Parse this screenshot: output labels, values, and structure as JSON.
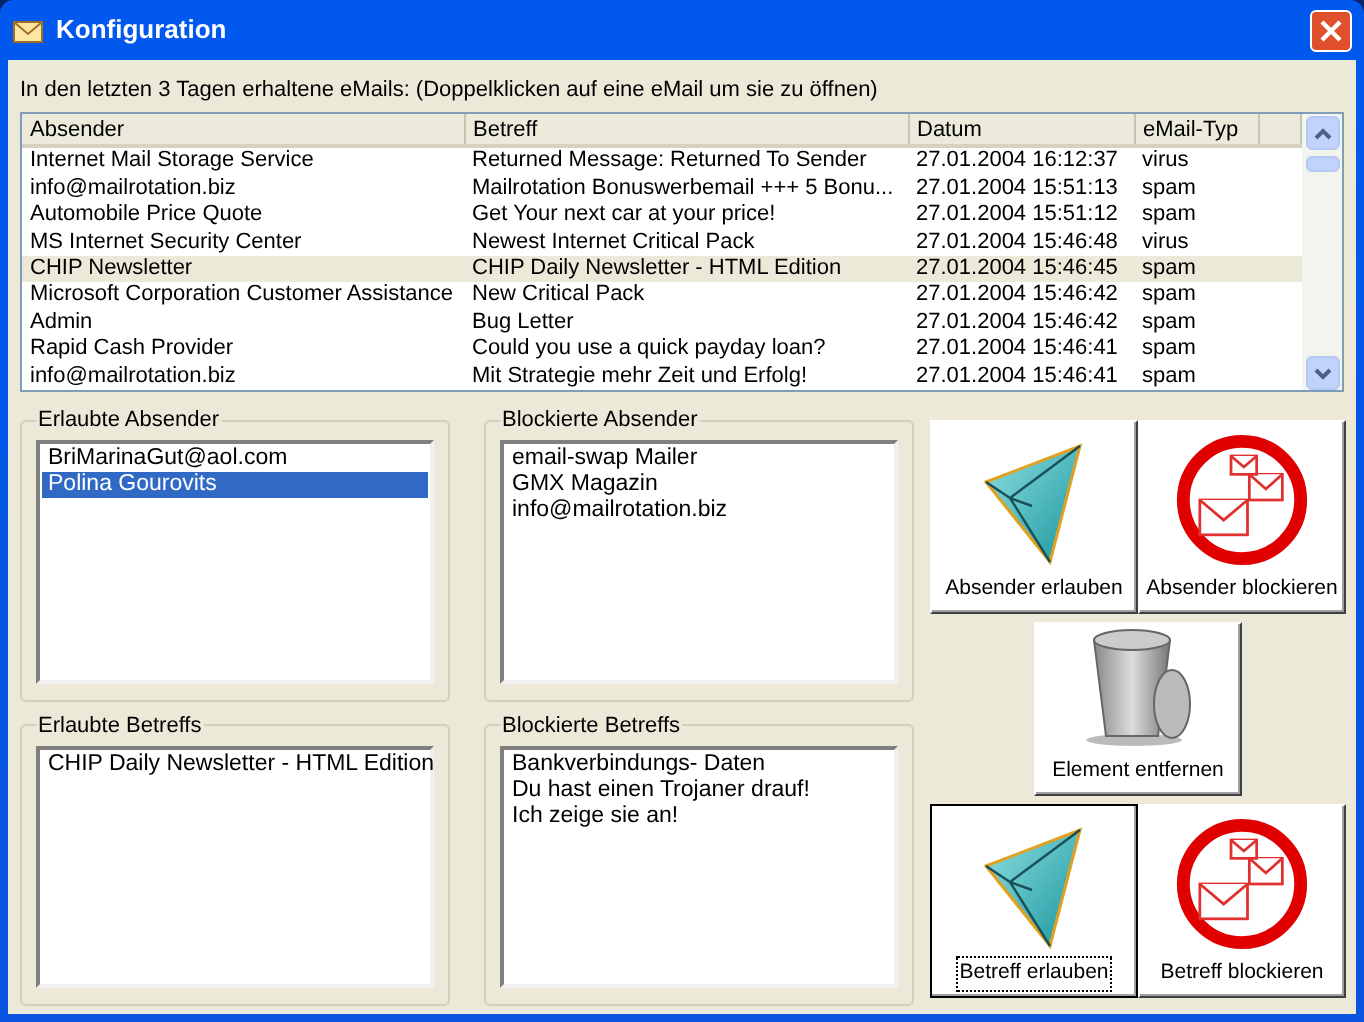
{
  "window": {
    "title": "Konfiguration"
  },
  "caption": "In den letzten 3 Tagen erhaltene eMails: (Doppelklicken auf eine eMail um sie zu öffnen)",
  "emails": {
    "columns": [
      "Absender",
      "Betreff",
      "Datum",
      "eMail-Typ"
    ],
    "rows": [
      {
        "cells": [
          "Internet Mail Storage Service",
          "Returned Message: Returned To Sender",
          "27.01.2004 16:12:37",
          "virus"
        ],
        "selected": false
      },
      {
        "cells": [
          "info@mailrotation.biz",
          "Mailrotation Bonuswerbemail +++ 5 Bonu...",
          "27.01.2004 15:51:13",
          "spam"
        ],
        "selected": false
      },
      {
        "cells": [
          "Automobile Price Quote",
          "Get Your next car at your price!",
          "27.01.2004 15:51:12",
          "spam"
        ],
        "selected": false
      },
      {
        "cells": [
          "MS Internet Security Center",
          "Newest Internet Critical Pack",
          "27.01.2004 15:46:48",
          "virus"
        ],
        "selected": false
      },
      {
        "cells": [
          "CHIP Newsletter",
          "CHIP Daily Newsletter - HTML Edition",
          "27.01.2004 15:46:45",
          "spam"
        ],
        "selected": true
      },
      {
        "cells": [
          "Microsoft Corporation Customer Assistance",
          "New Critical Pack",
          "27.01.2004 15:46:42",
          "spam"
        ],
        "selected": false
      },
      {
        "cells": [
          "Admin",
          "Bug Letter",
          "27.01.2004 15:46:42",
          "spam"
        ],
        "selected": false
      },
      {
        "cells": [
          "Rapid Cash Provider",
          "Could you use a quick payday loan?",
          "27.01.2004 15:46:41",
          "spam"
        ],
        "selected": false
      },
      {
        "cells": [
          "info@mailrotation.biz",
          "Mit Strategie mehr Zeit und Erfolg!",
          "27.01.2004 15:46:41",
          "spam"
        ],
        "selected": false
      }
    ]
  },
  "lists": [
    {
      "title": "Erlaubte Absender",
      "items": [
        {
          "text": "BriMarinaGut@aol.com",
          "selected": false
        },
        {
          "text": "Polina Gourovits",
          "selected": true
        }
      ]
    },
    {
      "title": "Blockierte Absender",
      "items": [
        {
          "text": "email-swap Mailer",
          "selected": false
        },
        {
          "text": "GMX Magazin",
          "selected": false
        },
        {
          "text": "info@mailrotation.biz",
          "selected": false
        }
      ]
    },
    {
      "title": "Erlaubte Betreffs",
      "items": [
        {
          "text": "CHIP Daily Newsletter - HTML Edition",
          "selected": false
        }
      ]
    },
    {
      "title": "Blockierte Betreffs",
      "items": [
        {
          "text": "Bankverbindungs- Daten",
          "selected": false
        },
        {
          "text": "Du hast einen Trojaner drauf!",
          "selected": false
        },
        {
          "text": "Ich zeige sie an!",
          "selected": false
        }
      ]
    }
  ],
  "buttons": [
    {
      "label": "Absender erlauben",
      "kind": "allow",
      "focused": false
    },
    {
      "label": "Absender blockieren",
      "kind": "block",
      "focused": false
    },
    {
      "label": "Element entfernen",
      "kind": "delete",
      "focused": false
    },
    {
      "label": "Betreff erlauben",
      "kind": "allow",
      "focused": true
    },
    {
      "label": "Betreff blockieren",
      "kind": "block",
      "focused": false
    }
  ]
}
